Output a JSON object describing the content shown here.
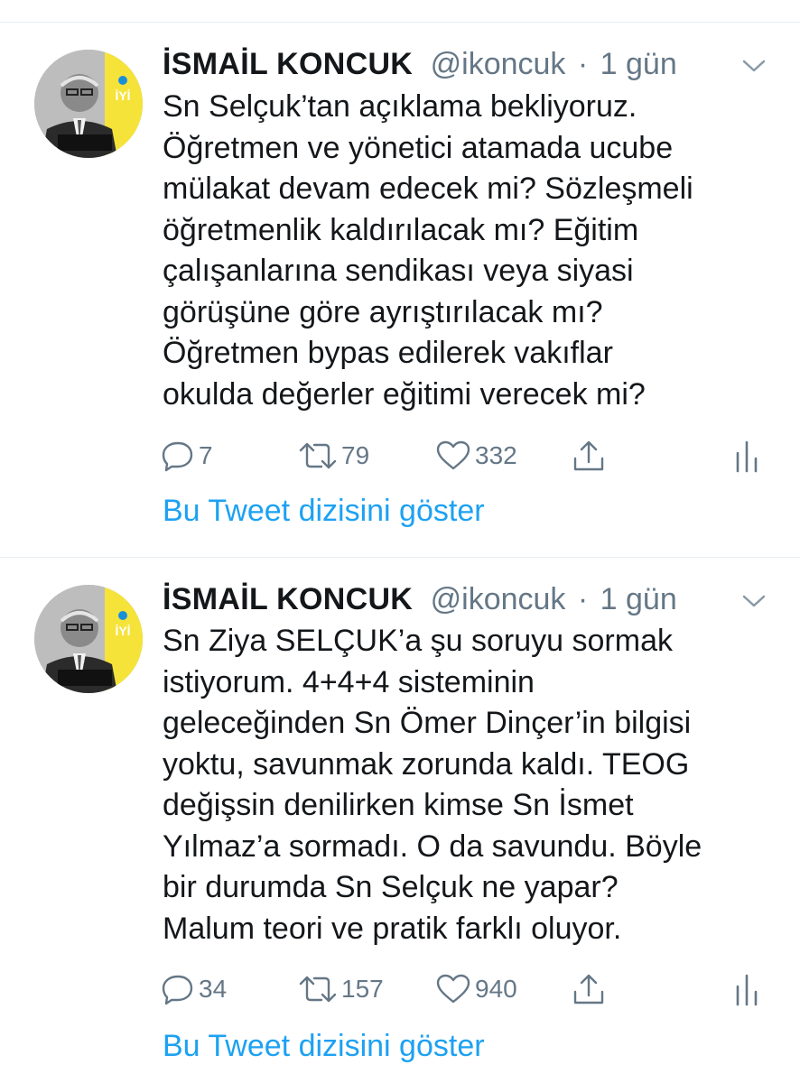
{
  "tweets": [
    {
      "name": "İSMAİL KONCUK",
      "handle": "@ikoncuk",
      "separator": "·",
      "time": "1 gün",
      "lines": [
        "Sn Selçuk’tan açıklama bekliyoruz.",
        "Öğretmen ve yönetici atamada ucube",
        "mülakat devam edecek mi? Sözleşmeli",
        "öğretmenlik kaldırılacak mı? Eğitim",
        "çalışanlarına sendikası veya siyasi",
        "görüşüne göre ayrıştırılacak mı?",
        "Öğretmen bypas edilerek vakıflar",
        "okulda değerler eğitimi verecek mi?"
      ],
      "replies": "7",
      "retweets": "79",
      "likes": "332",
      "show_thread": "Bu Tweet dizisini göster"
    },
    {
      "name": "İSMAİL KONCUK",
      "handle": "@ikoncuk",
      "separator": "·",
      "time": "1 gün",
      "lines": [
        "Sn Ziya SELÇUK’a şu soruyu sormak",
        "istiyorum. 4+4+4 sisteminin",
        "geleceğinden  Sn Ömer Dinçer’in bilgisi",
        "yoktu, savunmak zorunda kaldı. TEOG",
        "değişsin denilirken kimse Sn İsmet",
        "Yılmaz’a sormadı. O da savundu. Böyle",
        "bir durumda Sn Selçuk ne yapar?",
        "Malum teori ve pratik farklı oluyor."
      ],
      "replies": "34",
      "retweets": "157",
      "likes": "940",
      "show_thread": "Bu Tweet dizisini göster"
    }
  ],
  "avatar_badge": "İYİ",
  "colors": {
    "link": "#1da1f2",
    "muted": "#657786",
    "text": "#14171a",
    "divider": "#e6ecf0",
    "party_yellow": "#f6e33a"
  }
}
